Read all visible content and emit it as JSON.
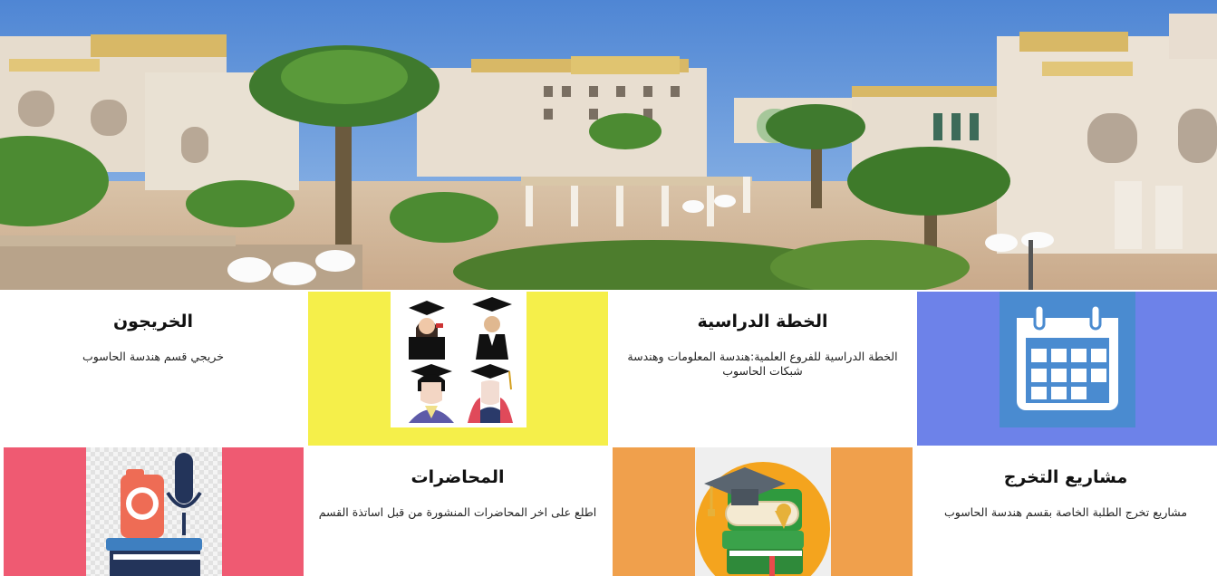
{
  "hero": {
    "image": "university-campus-courtyard",
    "sky_color": "#5e95d8",
    "building_color": "#e8ddd0"
  },
  "cards": {
    "graduates": {
      "title": "الخريجون",
      "description": "خريجي قسم هندسة الحاسوب"
    },
    "graduates_tile": {
      "bg": "#f5ef4a",
      "icon": "graduates-icon"
    },
    "study_plan": {
      "title": "الخطة الدراسية",
      "description": "الخطة الدراسية للفروع العلمية:هندسة المعلومات وهندسة شبكات الحاسوب"
    },
    "study_plan_tile": {
      "bg": "#6d82e9",
      "icon": "calendar-icon"
    },
    "lectures_tile": {
      "bg": "#ef5a72",
      "icon": "media-books-icon"
    },
    "lectures": {
      "title": "المحاضرات",
      "description": "اطلع على اخر المحاضرات المنشورة من قبل اساتذة القسم"
    },
    "projects_tile": {
      "bg": "#f0a04c",
      "icon": "graduation-cap-books-icon"
    },
    "projects": {
      "title": "مشاريع التخرج",
      "description": "مشاريع تخرج الطلبة الخاصة بقسم هندسة الحاسوب"
    }
  }
}
